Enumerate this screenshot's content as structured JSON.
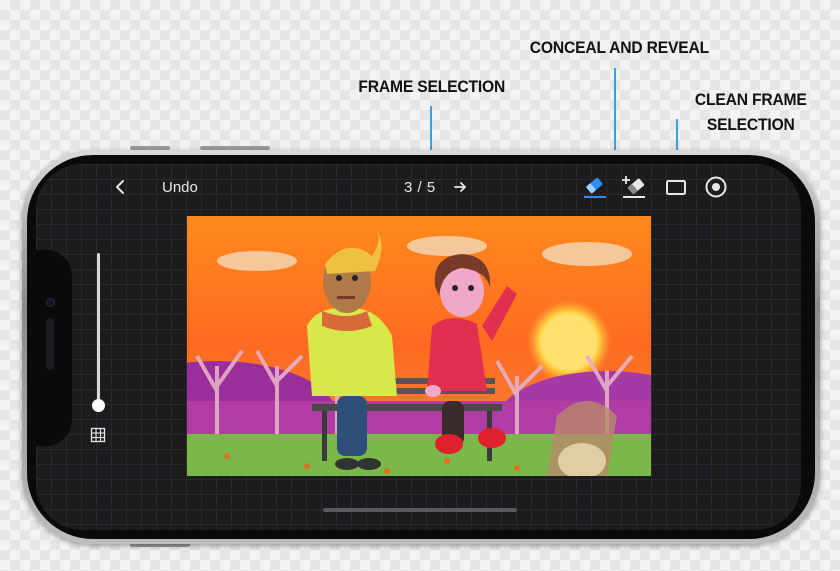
{
  "callouts": {
    "frame_selection": "FRAME SELECTION",
    "conceal_reveal": "CONCEAL AND REVEAL",
    "clean_line1": "CLEAN FRAME",
    "clean_line2": "SELECTION"
  },
  "toolbar": {
    "back_icon": "chevron-left-icon",
    "undo_label": "Undo",
    "frame_counter": "3 / 5",
    "next_icon": "arrow-right-icon",
    "tools": [
      "eraser-icon",
      "add-eraser-icon",
      "rectangle-icon",
      "record-icon"
    ],
    "active_tool": "eraser-icon"
  },
  "sidebar": {
    "slider_level": 0.1,
    "grid_icon": "grid-icon"
  },
  "canvas": {
    "artwork": "claymation scene: two clay figures holding hands on a park bench at sunset"
  },
  "colors": {
    "accent_blue": "#2f8ef0",
    "leader_line": "#3aa0d8",
    "toolbar_text": "#e8e8e8",
    "screen_bg": "#1c1c1f"
  }
}
